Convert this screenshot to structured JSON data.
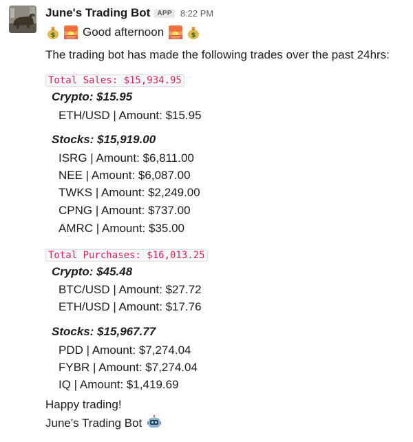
{
  "message": {
    "sender": "June's Trading Bot",
    "badge": "APP",
    "time": "8:22 PM",
    "greeting": "Good afternoon",
    "intro": "The trading bot has made the following trades over the past 24hrs:",
    "sales": {
      "total_label": "Total Sales: $15,934.95",
      "crypto": {
        "label": "Crypto: $15.95",
        "items": [
          "ETH/USD | Amount: $15.95"
        ]
      },
      "stocks": {
        "label": "Stocks: $15,919.00",
        "items": [
          "ISRG | Amount: $6,811.00",
          "NEE | Amount: $6,087.00",
          "TWKS | Amount: $2,249.00",
          "CPNG | Amount: $737.00",
          "AMRC | Amount: $35.00"
        ]
      }
    },
    "purchases": {
      "total_label": "Total Purchases: $16,013.25",
      "crypto": {
        "label": "Crypto: $45.48",
        "items": [
          "BTC/USD | Amount: $27.72",
          "ETH/USD | Amount: $17.76"
        ]
      },
      "stocks": {
        "label": "Stocks: $15,967.77",
        "items": [
          "PDD | Amount: $7,274.04",
          "FYBR | Amount: $7,274.04",
          "IQ | Amount: $1,419.69"
        ]
      }
    },
    "closing": "Happy trading!",
    "signature": "June's Trading Bot",
    "emojis": {
      "money_bag": "money-bag",
      "sunrise": "sunrise",
      "robot": "robot"
    }
  }
}
